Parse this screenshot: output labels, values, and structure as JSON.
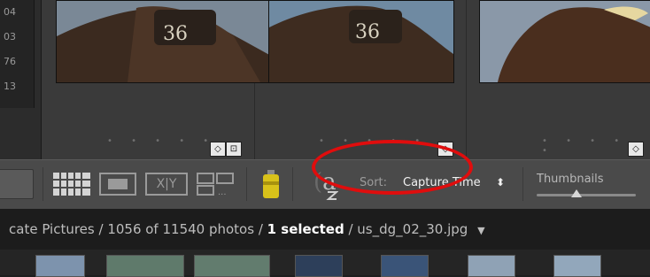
{
  "left_panel": {
    "counts": [
      "04",
      "03",
      "76",
      "13"
    ]
  },
  "grid": {
    "cells": [
      {
        "number": "36",
        "badges": [
          "tag-icon",
          "crop-icon"
        ]
      },
      {
        "number": "36",
        "badges": [
          "tag-icon"
        ]
      },
      {
        "number": "",
        "badges": [
          "tag-icon"
        ]
      }
    ],
    "dots": "• • • • •"
  },
  "toolbar": {
    "sort_label": "Sort:",
    "sort_value": "Capture Time",
    "sort_arrow": "⬍",
    "thumbnails_label": "Thumbnails",
    "thumbnail_size": 0.4,
    "az_glyph": "a"
  },
  "status": {
    "source": "cate Pictures",
    "sep1": " / ",
    "count": "1056 of 11540 photos",
    "sep2": " / ",
    "selected": "1 selected",
    "sep3": " / ",
    "filename": "us_dg_02_30.jpg",
    "dropdown": "▼"
  },
  "colors": {
    "annotation": "#e00d0d",
    "toolbar_bg": "#4a4a4a",
    "grid_bg": "#3a3a3a"
  }
}
